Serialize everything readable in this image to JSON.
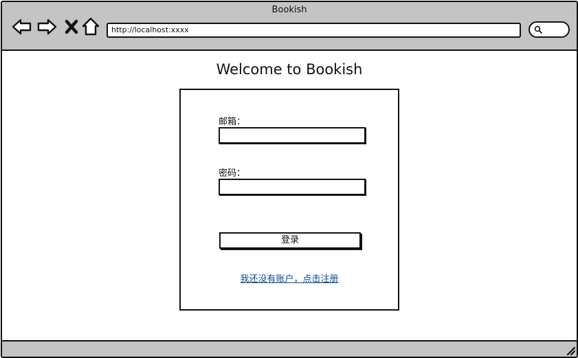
{
  "window": {
    "title": "Bookish"
  },
  "toolbar": {
    "url": "http://localhost:xxxx",
    "icons": [
      "back-arrow-icon",
      "forward-arrow-icon",
      "close-x-icon",
      "home-icon",
      "search-icon"
    ]
  },
  "page": {
    "heading": "Welcome to Bookish"
  },
  "login": {
    "email_label": "邮箱：",
    "email_value": "",
    "password_label": "密码：",
    "password_value": "",
    "submit_label": "登录",
    "register_link": "我还没有账户，点击注册"
  },
  "colors": {
    "chrome": "#c4c4c4",
    "border": "#111111",
    "link": "#0b4a8a",
    "background": "#ffffff"
  }
}
